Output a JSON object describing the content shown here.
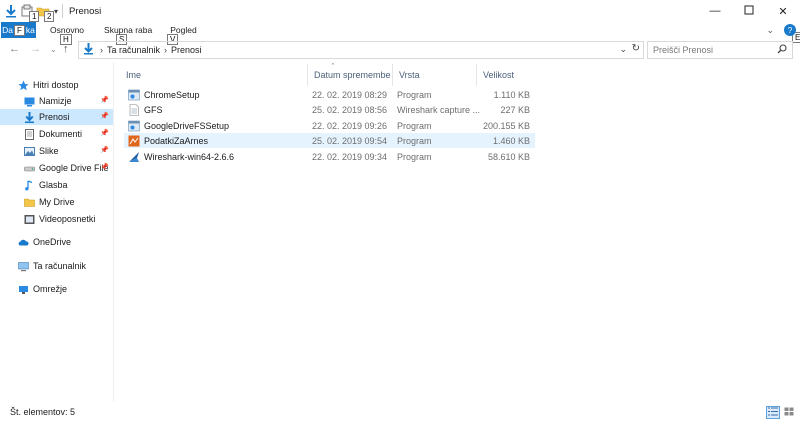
{
  "window": {
    "title": "Prenosi"
  },
  "keytips": {
    "qat1": "1",
    "qat2": "2",
    "file": "F",
    "home": "H",
    "share": "S",
    "view": "V",
    "help": "E"
  },
  "ribbon": {
    "file_tab_left": "Da",
    "file_tab_right": "ka",
    "tabs": [
      "Osnovno",
      "Skupna raba",
      "Pogled"
    ]
  },
  "address": {
    "crumbs": [
      "Ta računalnik",
      "Prenosi"
    ],
    "search_placeholder": "Preišči Prenosi"
  },
  "sidebar": {
    "items": [
      {
        "label": "Hitri dostop",
        "icon": "star-icon",
        "pinned": false,
        "selected": false
      },
      {
        "label": "Namizje",
        "icon": "desktop-icon",
        "pinned": true,
        "selected": false
      },
      {
        "label": "Prenosi",
        "icon": "download-icon",
        "pinned": true,
        "selected": true
      },
      {
        "label": "Dokumenti",
        "icon": "documents-icon",
        "pinned": true,
        "selected": false
      },
      {
        "label": "Slike",
        "icon": "pictures-icon",
        "pinned": true,
        "selected": false
      },
      {
        "label": "Google Drive File",
        "icon": "drive-folder-icon",
        "pinned": true,
        "selected": false
      },
      {
        "label": "Glasba",
        "icon": "music-icon",
        "pinned": false,
        "selected": false
      },
      {
        "label": "My Drive",
        "icon": "folder-icon",
        "pinned": false,
        "selected": false
      },
      {
        "label": "Videoposnetki",
        "icon": "video-icon",
        "pinned": false,
        "selected": false
      },
      {
        "label": "OneDrive",
        "icon": "cloud-icon",
        "pinned": false,
        "selected": false
      },
      {
        "label": "Ta računalnik",
        "icon": "computer-icon",
        "pinned": false,
        "selected": false
      },
      {
        "label": "Omrežje",
        "icon": "network-icon",
        "pinned": false,
        "selected": false
      }
    ]
  },
  "columns": {
    "name": "Ime",
    "date": "Datum spremembe",
    "type": "Vrsta",
    "size": "Velikost"
  },
  "files": [
    {
      "name": "ChromeSetup",
      "date": "22. 02. 2019 08:29",
      "type": "Program",
      "size": "1.110 KB",
      "icon": "installer-icon",
      "selected": false
    },
    {
      "name": "GFS",
      "date": "25. 02. 2019 08:56",
      "type": "Wireshark capture ...",
      "size": "227 KB",
      "icon": "capture-file-icon",
      "selected": false
    },
    {
      "name": "GoogleDriveFSSetup",
      "date": "22. 02. 2019 09:26",
      "type": "Program",
      "size": "200.155 KB",
      "icon": "installer-icon",
      "selected": false
    },
    {
      "name": "PodatkiZaArnes",
      "date": "25. 02. 2019 09:54",
      "type": "Program",
      "size": "1.460 KB",
      "icon": "program-icon",
      "selected": true
    },
    {
      "name": "Wireshark-win64-2.6.6",
      "date": "22. 02. 2019 09:34",
      "type": "Program",
      "size": "58.610 KB",
      "icon": "wireshark-icon",
      "selected": false
    }
  ],
  "status": {
    "text": "Št. elementov: 5"
  },
  "colors": {
    "accent": "#1979ca",
    "selection": "#cce8ff",
    "row_hover": "#e5f3ff",
    "header_text": "#4c607a"
  }
}
